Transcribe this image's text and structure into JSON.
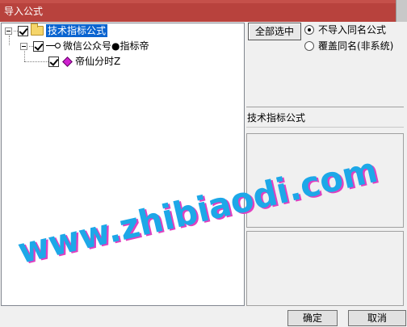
{
  "window": {
    "title": "导入公式"
  },
  "tree": {
    "root_label": "技术指标公式",
    "child_label": "微信公众号●指标帝",
    "leaf_label": "帝仙分时Z"
  },
  "options": {
    "select_all_label": "全部选中",
    "radio_skip_label": "不导入同名公式",
    "radio_overwrite_label": "覆盖同名(非系统)",
    "selected": "skip"
  },
  "info": {
    "category_text": "技术指标公式"
  },
  "buttons": {
    "ok_label": "确定",
    "cancel_label": "取消"
  },
  "watermark": {
    "text": "www.zhibiaodi.com"
  },
  "colors": {
    "titlebar": "#b8423d",
    "selection": "#0a64d0",
    "watermark_fill": "#1da8e8",
    "watermark_shadow": "#e040c0"
  }
}
